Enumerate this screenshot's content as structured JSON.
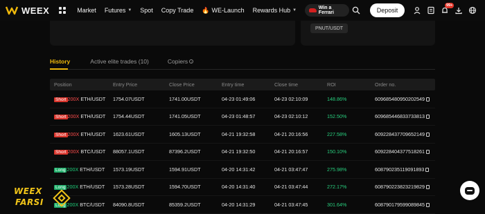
{
  "brand": {
    "name": "WEEX",
    "accent": "#f0b90b"
  },
  "nav": {
    "items": [
      {
        "label": "Market",
        "has_chevron": false
      },
      {
        "label": "Futures",
        "has_chevron": true
      },
      {
        "label": "Spot",
        "has_chevron": false
      },
      {
        "label": "Copy Trade",
        "has_chevron": false
      },
      {
        "label": "WE-Launch",
        "has_chevron": false,
        "icon": "fire-icon"
      },
      {
        "label": "Rewards Hub",
        "has_chevron": true
      }
    ],
    "promo_label": "Win a Ferrari",
    "deposit_label": "Deposit",
    "notification_badge": "99+"
  },
  "top_panel": {
    "pair_chip": "PNUT/USDT"
  },
  "tabs": [
    {
      "label": "History",
      "active": true
    },
    {
      "label": "Active elite trades (10)",
      "active": false
    },
    {
      "label": "Copiers",
      "active": false,
      "icon": "info-icon"
    }
  ],
  "table": {
    "headers": [
      "Position",
      "Entry Price",
      "Close Price",
      "Entry time",
      "Close time",
      "ROI",
      "Order no."
    ],
    "rows": [
      {
        "side": "Short",
        "leverage": "200X",
        "pair": "ETH/USDT",
        "entry_price": "1754.07USDT",
        "close_price": "1741.00USDT",
        "entry_time": "04-23 01:49:06",
        "close_time": "04-23 02:10:09",
        "roi": "148.86%",
        "order_no": "609685480950202549"
      },
      {
        "side": "Short",
        "leverage": "200X",
        "pair": "ETH/USDT",
        "entry_price": "1754.44USDT",
        "close_price": "1741.05USDT",
        "entry_time": "04-23 01:48:57",
        "close_time": "04-23 02:10:12",
        "roi": "152.50%",
        "order_no": "609685446833733813"
      },
      {
        "side": "Short",
        "leverage": "200X",
        "pair": "ETH/USDT",
        "entry_price": "1623.61USDT",
        "close_price": "1605.13USDT",
        "entry_time": "04-21 19:32:58",
        "close_time": "04-21 20:16:56",
        "roi": "227.58%",
        "order_no": "609228437709652149"
      },
      {
        "side": "Short",
        "leverage": "200X",
        "pair": "BTC/USDT",
        "entry_price": "88057.1USDT",
        "close_price": "87396.2USDT",
        "entry_time": "04-21 19:32:50",
        "close_time": "04-21 20:16:57",
        "roi": "150.10%",
        "order_no": "609228404377518261"
      },
      {
        "side": "Long",
        "leverage": "200X",
        "pair": "ETH/USDT",
        "entry_price": "1573.19USDT",
        "close_price": "1594.91USDT",
        "entry_time": "04-20 14:31:42",
        "close_time": "04-21 03:47:47",
        "roi": "275.98%",
        "order_no": "608790235119091893"
      },
      {
        "side": "Long",
        "leverage": "200X",
        "pair": "ETH/USDT",
        "entry_price": "1573.28USDT",
        "close_price": "1594.70USDT",
        "entry_time": "04-20 14:31:40",
        "close_time": "04-21 03:47:44",
        "roi": "272.17%",
        "order_no": "608790223823219829"
      },
      {
        "side": "Long",
        "leverage": "200X",
        "pair": "BTC/USDT",
        "entry_price": "84090.8USDT",
        "close_price": "85359.2USDT",
        "entry_time": "04-20 14:31:29",
        "close_time": "04-21 03:47:45",
        "roi": "301.64%",
        "order_no": "608790179599089845"
      }
    ]
  },
  "watermark": {
    "line1": "WEEX",
    "line2": "FARSI"
  }
}
